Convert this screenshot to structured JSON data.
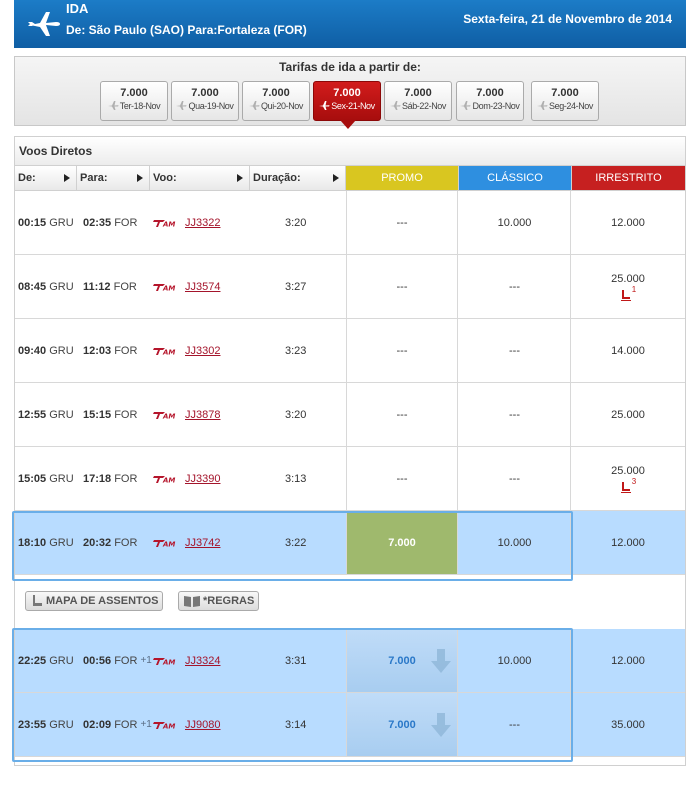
{
  "header": {
    "title": "IDA",
    "route": "De: São Paulo (SAO) Para:Fortaleza (FOR)",
    "date": "Sexta-feira, 21 de Novembro de 2014"
  },
  "fares": {
    "title": "Tarifas de ida a partir de:",
    "items": [
      {
        "value": "7.000",
        "date": "Ter-18-Nov",
        "active": false
      },
      {
        "value": "7.000",
        "date": "Qua-19-Nov",
        "active": false
      },
      {
        "value": "7.000",
        "date": "Qui-20-Nov",
        "active": false
      },
      {
        "value": "7.000",
        "date": "Sex-21-Nov",
        "active": true
      },
      {
        "value": "7.000",
        "date": "Sáb-22-Nov",
        "active": false
      },
      {
        "value": "7.000",
        "date": "Dom-23-Nov",
        "active": false
      },
      {
        "value": "7.000",
        "date": "Seg-24-Nov",
        "active": false
      }
    ]
  },
  "table": {
    "title": "Voos Diretos",
    "headers": {
      "dep": "De:",
      "arr": "Para:",
      "flight": "Voo:",
      "duration": "Duração:",
      "promo": "PROMO",
      "classico": "CLÁSSICO",
      "irrestrito": "IRRESTRITO"
    },
    "colors": {
      "promo": "#d9c620",
      "classico": "#2e8fe0",
      "irrestrito": "#c62020"
    },
    "rows": [
      {
        "dep_time": "00:15",
        "dep_ap": "GRU",
        "arr_time": "02:35",
        "arr_ap": "FOR",
        "plus": "",
        "flight": "JJ3322",
        "duration": "3:20",
        "promo": "---",
        "classico": "10.000",
        "irrestrito": "12.000",
        "seat": ""
      },
      {
        "dep_time": "08:45",
        "dep_ap": "GRU",
        "arr_time": "11:12",
        "arr_ap": "FOR",
        "plus": "",
        "flight": "JJ3574",
        "duration": "3:27",
        "promo": "---",
        "classico": "---",
        "irrestrito": "25.000",
        "seat": "1"
      },
      {
        "dep_time": "09:40",
        "dep_ap": "GRU",
        "arr_time": "12:03",
        "arr_ap": "FOR",
        "plus": "",
        "flight": "JJ3302",
        "duration": "3:23",
        "promo": "---",
        "classico": "---",
        "irrestrito": "14.000",
        "seat": ""
      },
      {
        "dep_time": "12:55",
        "dep_ap": "GRU",
        "arr_time": "15:15",
        "arr_ap": "FOR",
        "plus": "",
        "flight": "JJ3878",
        "duration": "3:20",
        "promo": "---",
        "classico": "---",
        "irrestrito": "25.000",
        "seat": ""
      },
      {
        "dep_time": "15:05",
        "dep_ap": "GRU",
        "arr_time": "17:18",
        "arr_ap": "FOR",
        "plus": "",
        "flight": "JJ3390",
        "duration": "3:13",
        "promo": "---",
        "classico": "---",
        "irrestrito": "25.000",
        "seat": "3"
      },
      {
        "dep_time": "18:10",
        "dep_ap": "GRU",
        "arr_time": "20:32",
        "arr_ap": "FOR",
        "plus": "",
        "flight": "JJ3742",
        "duration": "3:22",
        "promo": "7.000",
        "classico": "10.000",
        "irrestrito": "12.000",
        "seat": ""
      },
      {
        "dep_time": "22:25",
        "dep_ap": "GRU",
        "arr_time": "00:56",
        "arr_ap": "FOR",
        "plus": "+1",
        "flight": "JJ3324",
        "duration": "3:31",
        "promo": "7.000",
        "classico": "10.000",
        "irrestrito": "12.000",
        "seat": ""
      },
      {
        "dep_time": "23:55",
        "dep_ap": "GRU",
        "arr_time": "02:09",
        "arr_ap": "FOR",
        "plus": "+1",
        "flight": "JJ9080",
        "duration": "3:14",
        "promo": "7.000",
        "classico": "---",
        "irrestrito": "35.000",
        "seat": ""
      }
    ],
    "actions": {
      "seat_map": "MAPA DE ASSENTOS",
      "rules": "*REGRAS"
    }
  }
}
